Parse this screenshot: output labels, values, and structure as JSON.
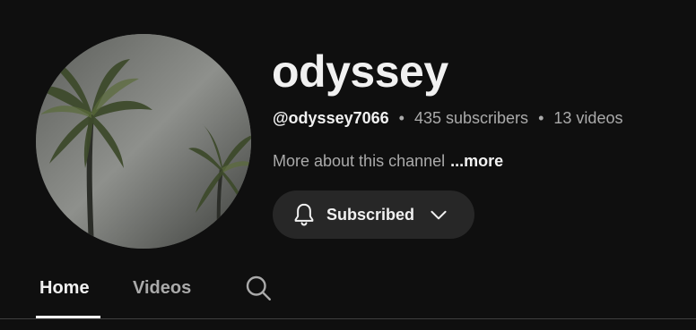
{
  "channel": {
    "name": "odyssey",
    "handle": "@odyssey7066",
    "subscribers": "435 subscribers",
    "videos": "13 videos",
    "separator": "•",
    "about_text": "More about this channel",
    "more_link": "...more"
  },
  "subscribe_button": {
    "label": "Subscribed",
    "icon": "bell-icon",
    "dropdown_icon": "chevron-down-icon"
  },
  "tabs": [
    {
      "label": "Home",
      "active": true
    },
    {
      "label": "Videos",
      "active": false
    }
  ],
  "search_icon": "search-icon",
  "colors": {
    "background": "#0f0f0f",
    "text_primary": "#f1f1f1",
    "text_secondary": "#aaaaaa",
    "button_bg": "#272727"
  }
}
